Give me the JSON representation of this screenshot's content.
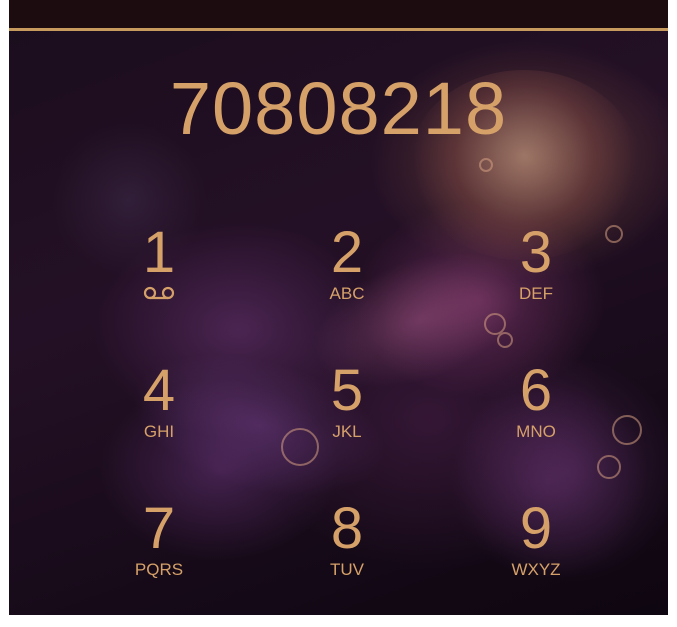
{
  "display": {
    "number": "70808218"
  },
  "keypad": {
    "keys": [
      {
        "digit": "1",
        "letters": "",
        "icon": "voicemail-icon"
      },
      {
        "digit": "2",
        "letters": "ABC"
      },
      {
        "digit": "3",
        "letters": "DEF"
      },
      {
        "digit": "4",
        "letters": "GHI"
      },
      {
        "digit": "5",
        "letters": "JKL"
      },
      {
        "digit": "6",
        "letters": "MNO"
      },
      {
        "digit": "7",
        "letters": "PQRS"
      },
      {
        "digit": "8",
        "letters": "TUV"
      },
      {
        "digit": "9",
        "letters": "WXYZ"
      }
    ]
  },
  "colors": {
    "accent": "#d6a169",
    "status_bar": "#1d0c0f",
    "status_line": "#c79a5e",
    "background": "#1a0d1c"
  }
}
